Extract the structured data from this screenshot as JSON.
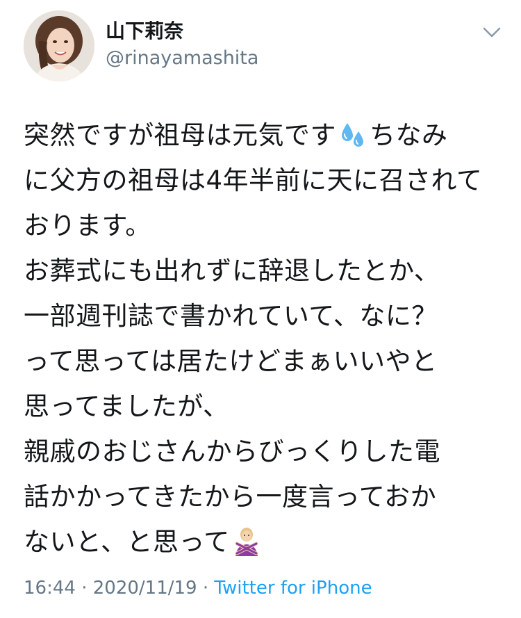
{
  "author": {
    "display_name": "山下莉奈",
    "handle": "@rinayamashita"
  },
  "tweet": {
    "lines": [
      {
        "text": "突然ですが祖母は元気です",
        "emoji": "sweat-droplets",
        "after": "ちなみ"
      },
      {
        "text": "に父方の祖母は4年半前に天に召されて"
      },
      {
        "text": "おります。"
      },
      {
        "text": "お葬式にも出れずに辞退したとか、"
      },
      {
        "text": "一部週刊誌で書かれていて、なに？"
      },
      {
        "text": "って思っては居たけどまぁいいやと"
      },
      {
        "text": "思ってましたが、"
      },
      {
        "text": "親戚のおじさんからびっくりした電"
      },
      {
        "text": "話かかってきたから一度言っておか"
      },
      {
        "text": "ないと、と思って",
        "emoji": "person-gesturing-no"
      }
    ]
  },
  "meta": {
    "time": "16:44",
    "separator": "·",
    "date": "2020/11/19",
    "source": "Twitter for iPhone"
  },
  "icons": {
    "menu": "chevron-down-icon",
    "emoji1": "sweat-droplets-icon",
    "emoji2": "person-gesturing-no-icon"
  },
  "colors": {
    "text": "#14171a",
    "secondary": "#657786",
    "link": "#1da1f2"
  }
}
